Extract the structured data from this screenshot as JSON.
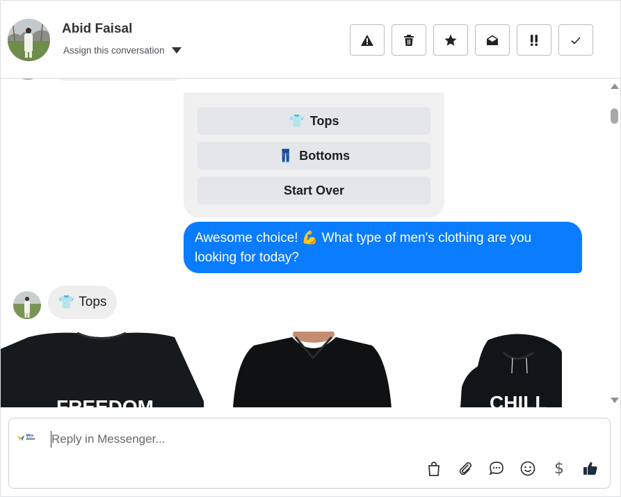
{
  "header": {
    "contact_name": "Abid Faisal",
    "assign_label": "Assign this conversation",
    "actions": [
      {
        "icon": "warning-icon",
        "label": "Report spam"
      },
      {
        "icon": "trash-icon",
        "label": "Delete"
      },
      {
        "icon": "star-icon",
        "label": "Star"
      },
      {
        "icon": "envelope-open-icon",
        "label": "Mark as unread"
      },
      {
        "icon": "double-exclamation-icon",
        "label": "Follow up"
      },
      {
        "icon": "check-icon",
        "label": "Mark as done"
      }
    ]
  },
  "conversation": {
    "quick_replies": [
      {
        "emoji": "👕",
        "label": "Tops"
      },
      {
        "emoji": "👖",
        "label": "Bottoms"
      },
      {
        "emoji": "",
        "label": "Start Over"
      }
    ],
    "bot_message": "Awesome choice! 💪 What type of men's clothing are you looking for today?",
    "user_message": {
      "emoji": "👕",
      "label": "Tops"
    },
    "products": [
      {
        "name": "black-tshirt",
        "print": "FREEDOM"
      },
      {
        "name": "black-polo",
        "print": ""
      },
      {
        "name": "black-hoodie",
        "print": "CHILL"
      }
    ]
  },
  "composer": {
    "placeholder": "Reply in Messenger...",
    "page_logo_text": "Mira Attire",
    "tools": [
      "shopping-bag-icon",
      "paperclip-icon",
      "chat-bubble-icon",
      "smiley-icon",
      "dollar-icon",
      "thumbs-up-icon"
    ]
  },
  "colors": {
    "accent": "#0a7cff",
    "bubble_gray": "#f0f0f0",
    "quick_reply_gray": "#e4e6eb"
  }
}
